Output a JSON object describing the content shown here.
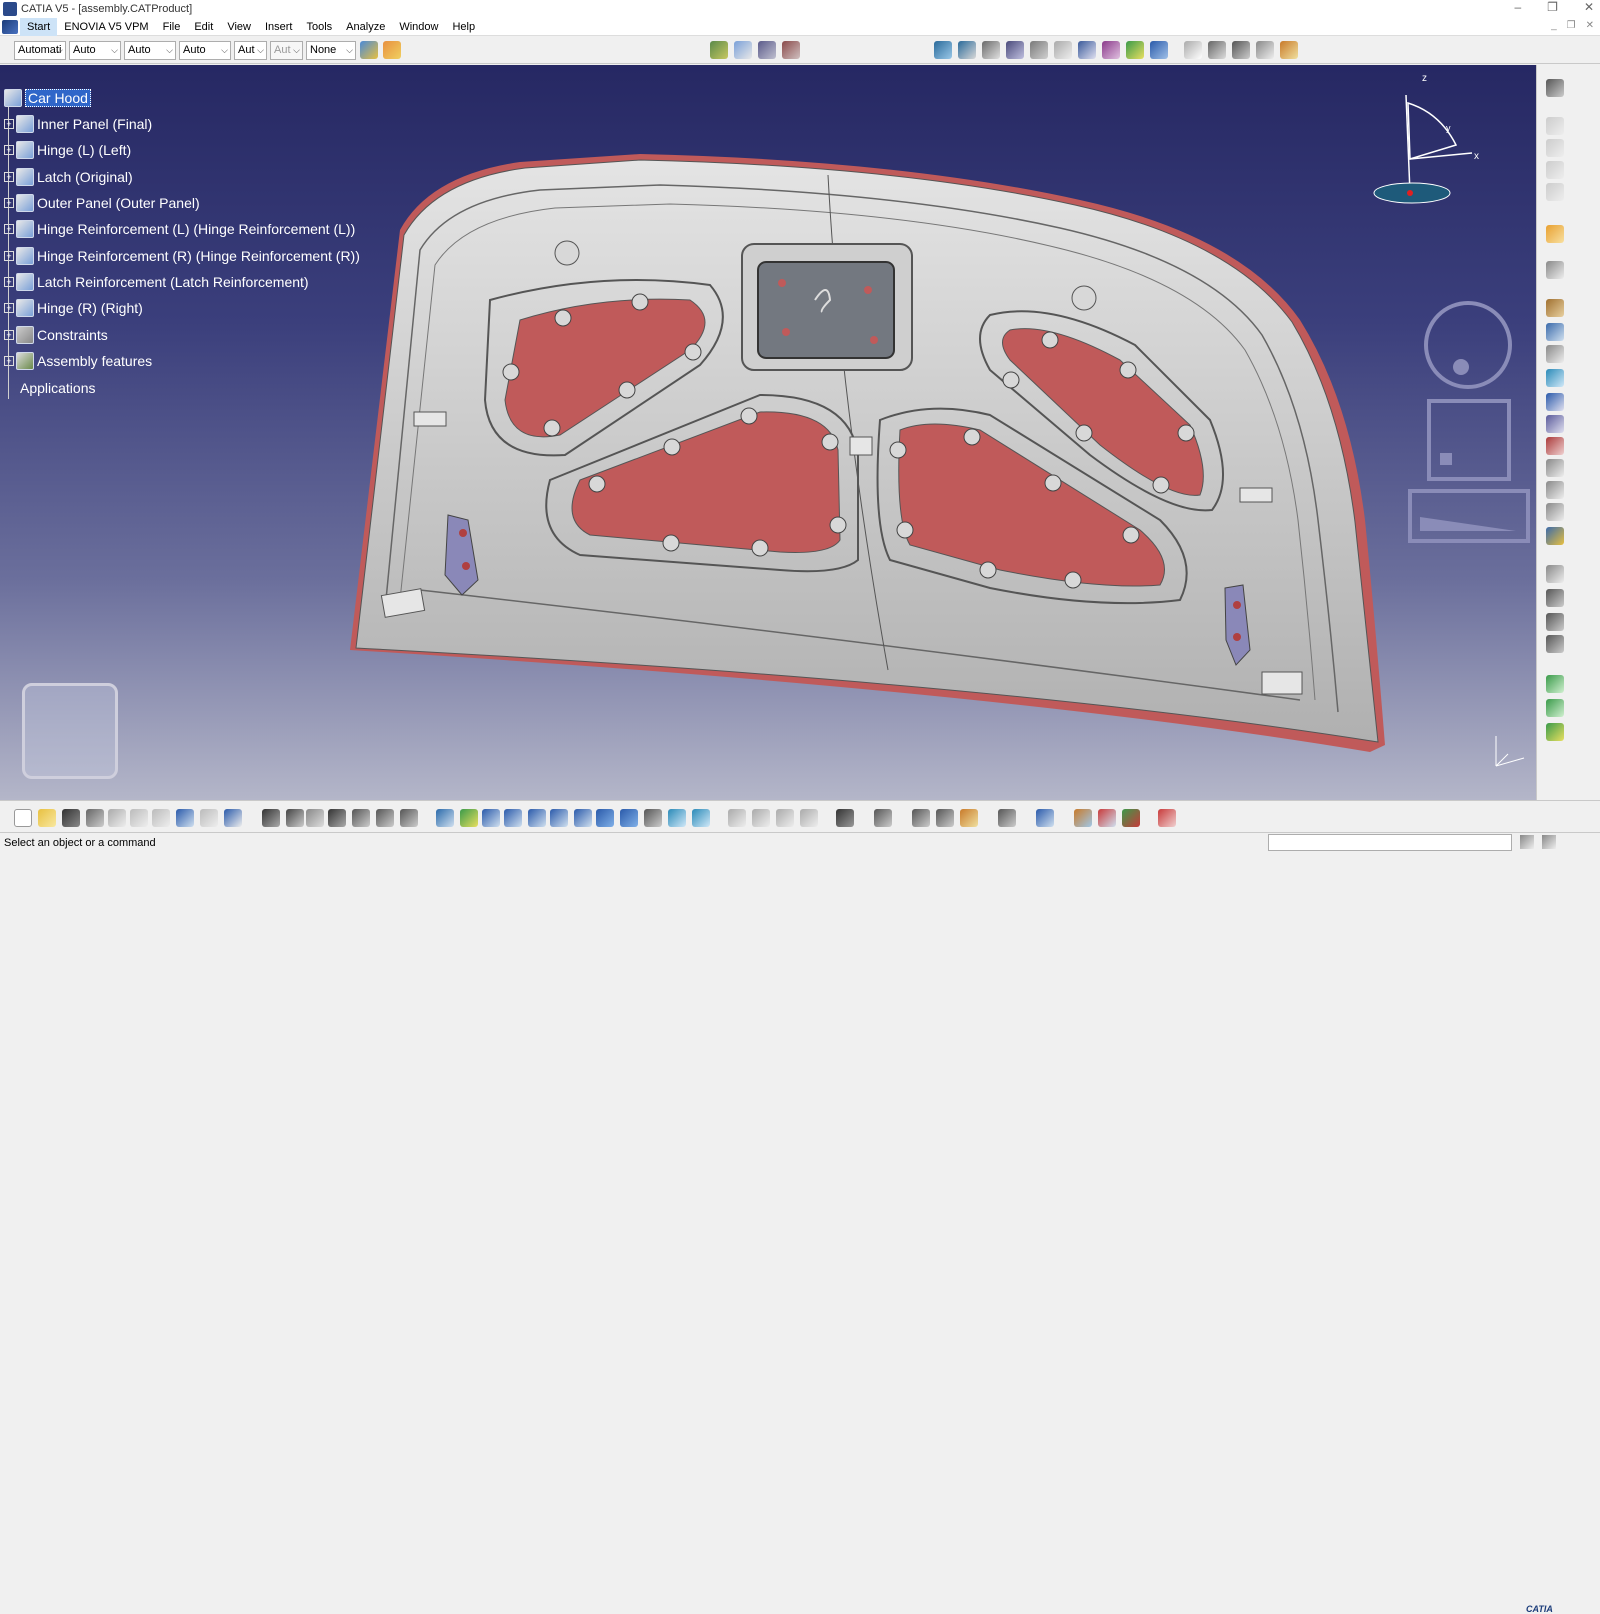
{
  "window": {
    "title": "CATIA V5 - [assembly.CATProduct]",
    "controls": [
      "–",
      "❐",
      "✕"
    ]
  },
  "menubar": {
    "items": [
      "Start",
      "ENOVIA V5 VPM",
      "File",
      "Edit",
      "View",
      "Insert",
      "Tools",
      "Analyze",
      "Window",
      "Help"
    ]
  },
  "toolbar": {
    "combos": [
      "Automati",
      "Auto",
      "Auto",
      "Auto",
      "Aut",
      "Aut",
      "None"
    ]
  },
  "tree": {
    "root": "Car Hood",
    "items": [
      "Inner Panel (Final)",
      "Hinge (L) (Left)",
      "Latch (Original)",
      "Outer Panel (Outer Panel)",
      "Hinge Reinforcement (L) (Hinge Reinforcement (L))",
      "Hinge Reinforcement (R) (Hinge Reinforcement (R))",
      "Latch Reinforcement (Latch Reinforcement)",
      "Hinge (R) (Right)",
      "Constraints",
      "Assembly features"
    ],
    "applications": "Applications"
  },
  "compass": {
    "z": "z",
    "y": "y",
    "x": "x"
  },
  "statusbar": {
    "message": "Select an object or a command"
  },
  "brand": {
    "logo_text": "CATIA"
  },
  "colors": {
    "viewport_top": "#262863",
    "viewport_bottom": "#b4b6c9",
    "part_gray": "#c9c9c9",
    "panel_red": "#c05a5a",
    "selection": "#2f66c9"
  }
}
